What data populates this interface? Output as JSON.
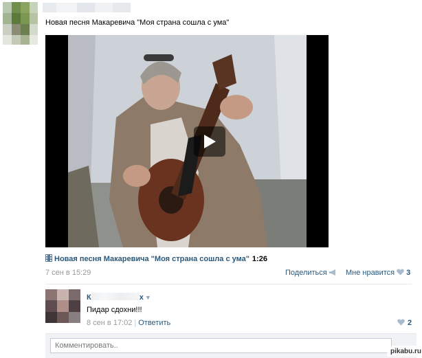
{
  "post": {
    "text": "Новая песня Макаревича \"Моя страна сошла с ума\"",
    "date": "7 сен в 15:29",
    "share_label": "Поделиться",
    "like_label": "Мне нравится",
    "like_count": "3"
  },
  "video": {
    "title": "Новая песня Макаревича \"Моя страна сошла с ума\"",
    "duration": "1:26",
    "play_icon": "play-icon",
    "film_icon": "film-icon"
  },
  "comment": {
    "author_visible_start": "К",
    "author_visible_end": "х",
    "text": "Пидар сдохни!!!",
    "date": "8 сен в 17:02",
    "reply_label": "Ответить",
    "like_count": "2"
  },
  "comment_box": {
    "placeholder": "Комментировать.."
  },
  "watermark": {
    "label": "pikabu.ru"
  },
  "colors": {
    "link": "#2b587a",
    "muted": "#999999",
    "heart": "#a9bccd",
    "background": "#ffffff"
  }
}
